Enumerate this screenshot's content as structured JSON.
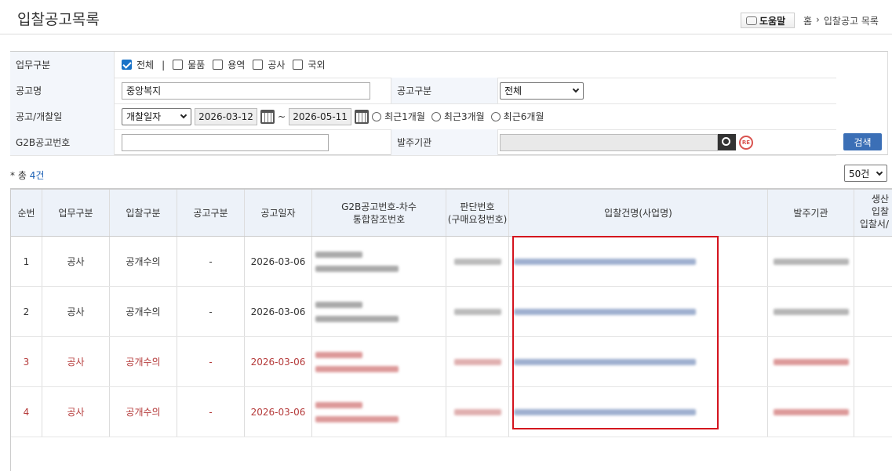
{
  "page": {
    "title": "입찰공고목록"
  },
  "header": {
    "help_label": "도움말",
    "crumb_home": "홈",
    "crumb_sep": "›",
    "crumb_current": "입찰공고 목록"
  },
  "search": {
    "business_type_label": "업무구분",
    "business_types": [
      {
        "label": "전체",
        "checked": true
      },
      {
        "label": "물품",
        "checked": false
      },
      {
        "label": "용역",
        "checked": false
      },
      {
        "label": "공사",
        "checked": false
      },
      {
        "label": "국외",
        "checked": false
      }
    ],
    "divider": "|",
    "notice_name_label": "공고명",
    "notice_name_value": "중앙복지",
    "notice_type_label": "공고구분",
    "notice_type_value": "전체",
    "date_label": "공고/개찰일",
    "date_kind_value": "개찰일자",
    "date_from": "2026-03-12",
    "date_to": "2026-05-11",
    "date_tilde": "~",
    "period_options": [
      "최근1개월",
      "최근3개월",
      "최근6개월"
    ],
    "g2b_label": "G2B공고번호",
    "g2b_value": "",
    "agency_label": "발주기관",
    "agency_value": "",
    "re_icon_text": "RE",
    "search_button": "검색"
  },
  "summary": {
    "prefix": "* 총",
    "count": "4건",
    "page_size": "50건"
  },
  "table": {
    "columns": {
      "no": "순번",
      "business": "업무구분",
      "bid_type": "입찰구분",
      "notice_type": "공고구분",
      "notice_date": "공고일자",
      "g2b_line1": "G2B공고번호-차수",
      "g2b_line2": "통합참조번호",
      "judge_line1": "판단번호",
      "judge_line2": "(구매요청번호)",
      "bid_name": "입찰건명(사업명)",
      "agency": "발주기관",
      "extra_line1": "생산",
      "extra_line2": "입찰",
      "extra_line3": "입찰서/"
    },
    "rows": [
      {
        "no": "1",
        "business": "공사",
        "bid_type": "공개수의",
        "notice_type": "-",
        "notice_date": "2026-03-06",
        "highlight": false
      },
      {
        "no": "2",
        "business": "공사",
        "bid_type": "공개수의",
        "notice_type": "-",
        "notice_date": "2026-03-06",
        "highlight": false
      },
      {
        "no": "3",
        "business": "공사",
        "bid_type": "공개수의",
        "notice_type": "-",
        "notice_date": "2026-03-06",
        "highlight": true
      },
      {
        "no": "4",
        "business": "공사",
        "bid_type": "공개수의",
        "notice_type": "-",
        "notice_date": "2026-03-06",
        "highlight": true
      }
    ]
  },
  "colors": {
    "accent": "#3b6fb6",
    "highlight_text": "#b53a3a",
    "annotation": "#d4141e",
    "header_bg": "#edf2f9"
  }
}
